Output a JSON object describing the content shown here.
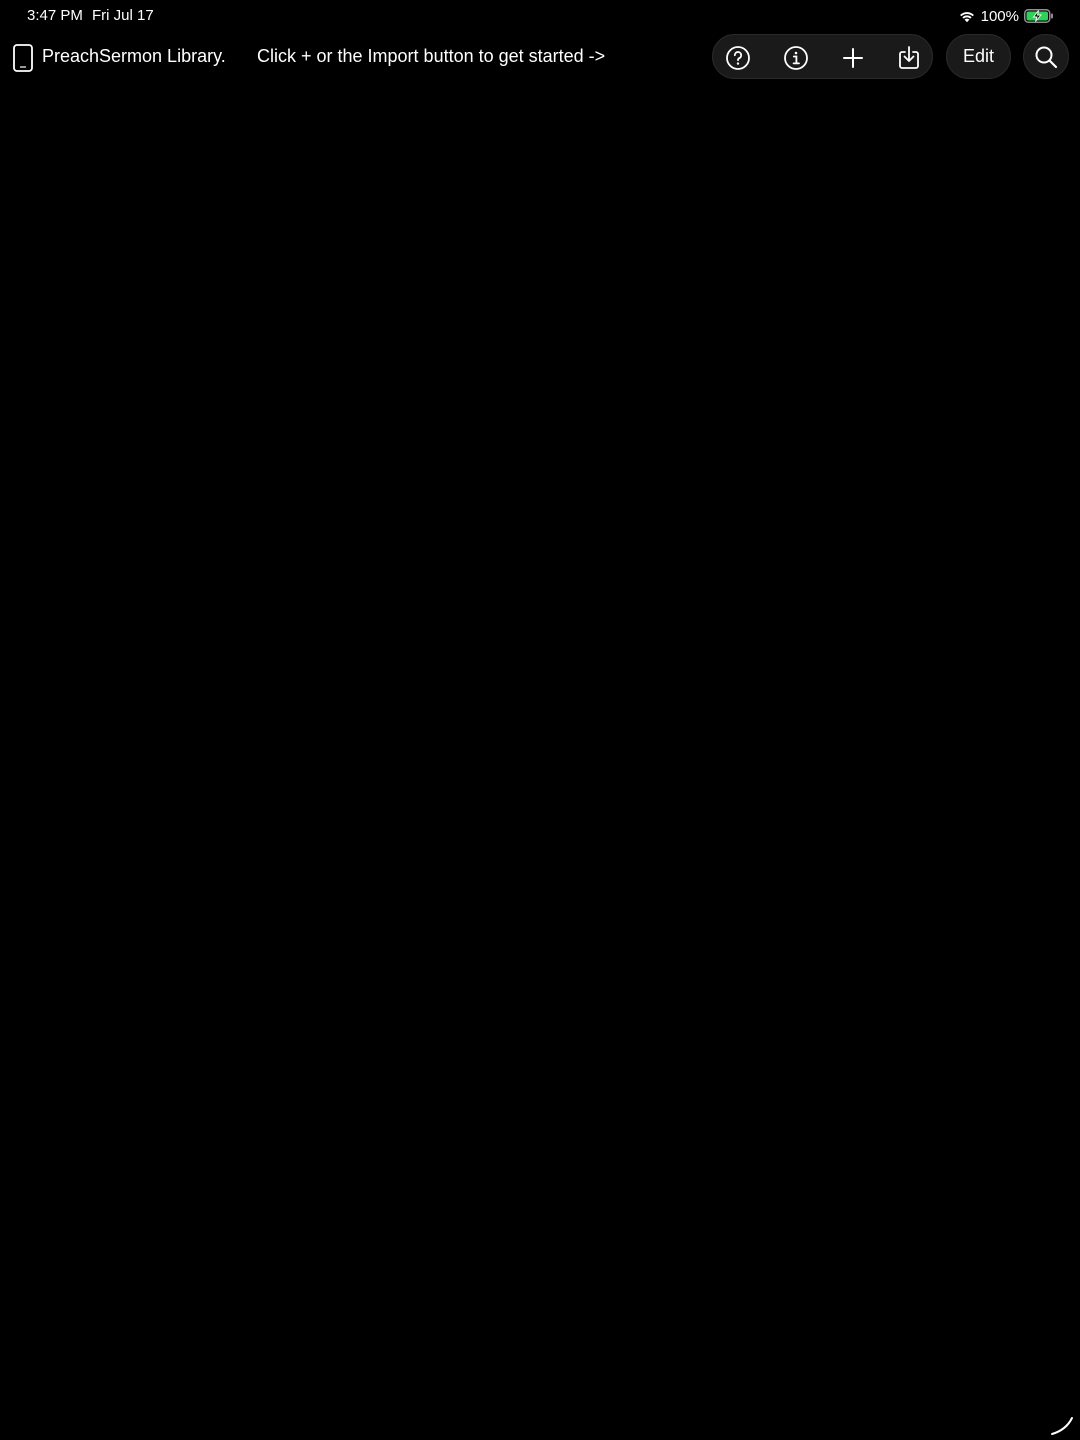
{
  "status_bar": {
    "time": "3:47 PM",
    "date": "Fri Jul 17",
    "battery_percent": "100%",
    "battery_charging": true,
    "battery_color": "#30d158",
    "wifi_icon": "wifi-icon",
    "battery_icon": "battery-charging-icon"
  },
  "nav": {
    "device_icon": "ipad-device-icon",
    "title": "PreachSermon Library.",
    "hint": "Click + or the Import button to get started ->",
    "toolbar": {
      "help_icon": "question-circle-icon",
      "info_icon": "info-circle-icon",
      "add_icon": "plus-icon",
      "import_icon": "import-tray-icon"
    },
    "edit_label": "Edit",
    "search_icon": "magnifying-glass-icon"
  },
  "theme": {
    "background": "#000000",
    "text": "#ffffff",
    "button_fill": "#1a1a1a"
  }
}
